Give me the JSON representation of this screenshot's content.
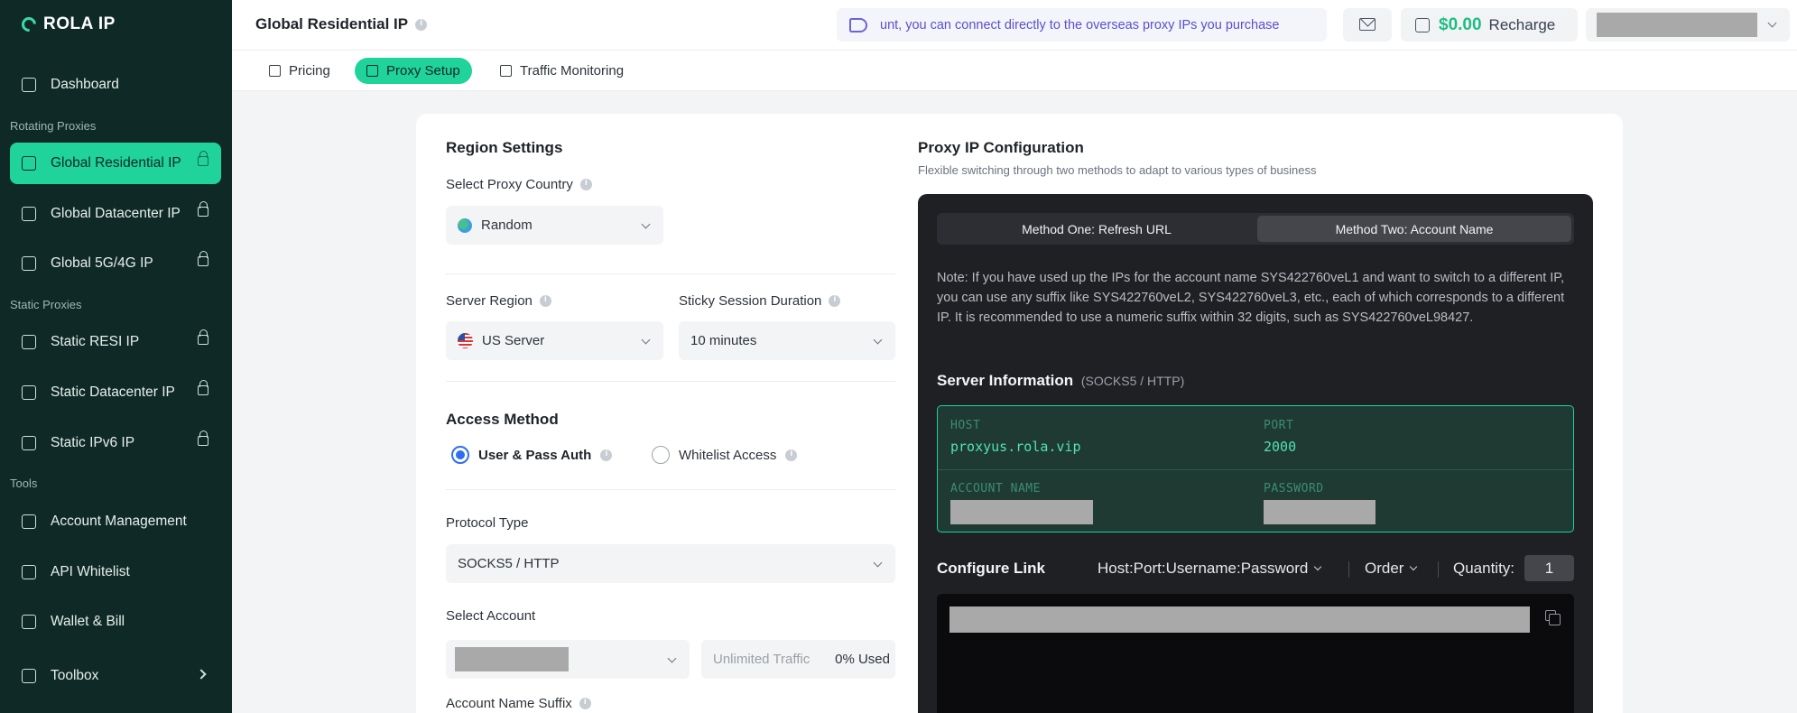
{
  "brand": {
    "name": "ROLA IP"
  },
  "sidebar": {
    "sections": {
      "rotating": "Rotating Proxies",
      "static": "Static Proxies",
      "tools": "Tools"
    },
    "items": [
      {
        "label": "Dashboard"
      },
      {
        "label": "Global Residential IP"
      },
      {
        "label": "Global Datacenter IP"
      },
      {
        "label": "Global 5G/4G IP"
      },
      {
        "label": "Static RESI IP"
      },
      {
        "label": "Static Datacenter IP"
      },
      {
        "label": "Static IPv6 IP"
      },
      {
        "label": "Account Management"
      },
      {
        "label": "API Whitelist"
      },
      {
        "label": "Wallet & Bill"
      },
      {
        "label": "Toolbox"
      }
    ]
  },
  "header": {
    "title": "Global Residential IP",
    "notice": "unt, you can connect directly to the overseas proxy IPs you purchase",
    "balance": "$0.00",
    "recharge": "Recharge"
  },
  "tabs": [
    {
      "label": "Pricing"
    },
    {
      "label": "Proxy Setup"
    },
    {
      "label": "Traffic Monitoring"
    }
  ],
  "region": {
    "title": "Region Settings",
    "country_label": "Select Proxy Country",
    "country_value": "Random",
    "server_region_label": "Server Region",
    "server_region_value": "US Server",
    "sticky_label": "Sticky Session Duration",
    "sticky_value": "10 minutes"
  },
  "access": {
    "title": "Access Method",
    "option1": "User & Pass Auth",
    "option2": "Whitelist Access",
    "protocol_label": "Protocol Type",
    "protocol_value": "SOCKS5 / HTTP",
    "account_label": "Select Account",
    "traffic_label": "Unlimited Traffic",
    "traffic_used": "0% Used",
    "suffix_label": "Account Name Suffix"
  },
  "config": {
    "title": "Proxy IP Configuration",
    "subtitle": "Flexible switching through two methods to adapt to various types of business",
    "method1": "Method One: Refresh URL",
    "method2": "Method Two: Account Name",
    "note": "Note: If you have used up the IPs for the account name SYS422760veL1 and want to switch to a different IP, you can use any suffix like SYS422760veL2, SYS422760veL3, etc., each of which corresponds to a different IP. It is recommended to use a numeric suffix within 32 digits, such as SYS422760veL98427.",
    "server_title": "Server Information",
    "server_paren": "(SOCKS5 / HTTP)",
    "host_label": "HOST",
    "host_value": "proxyus.rola.vip",
    "port_label": "PORT",
    "port_value": "2000",
    "account_name_label": "ACCOUNT NAME",
    "password_label": "PASSWORD",
    "link_title": "Configure Link",
    "link_format": "Host:Port:Username:Password",
    "order": "Order",
    "quantity_label": "Quantity:",
    "quantity_value": "1"
  },
  "colors": {
    "accent": "#1fd39a",
    "sidebar_bg": "#0f2a26",
    "balance": "#1fbd85",
    "notice_text": "#5a4fcf",
    "radio_selected": "#2f6df6"
  }
}
